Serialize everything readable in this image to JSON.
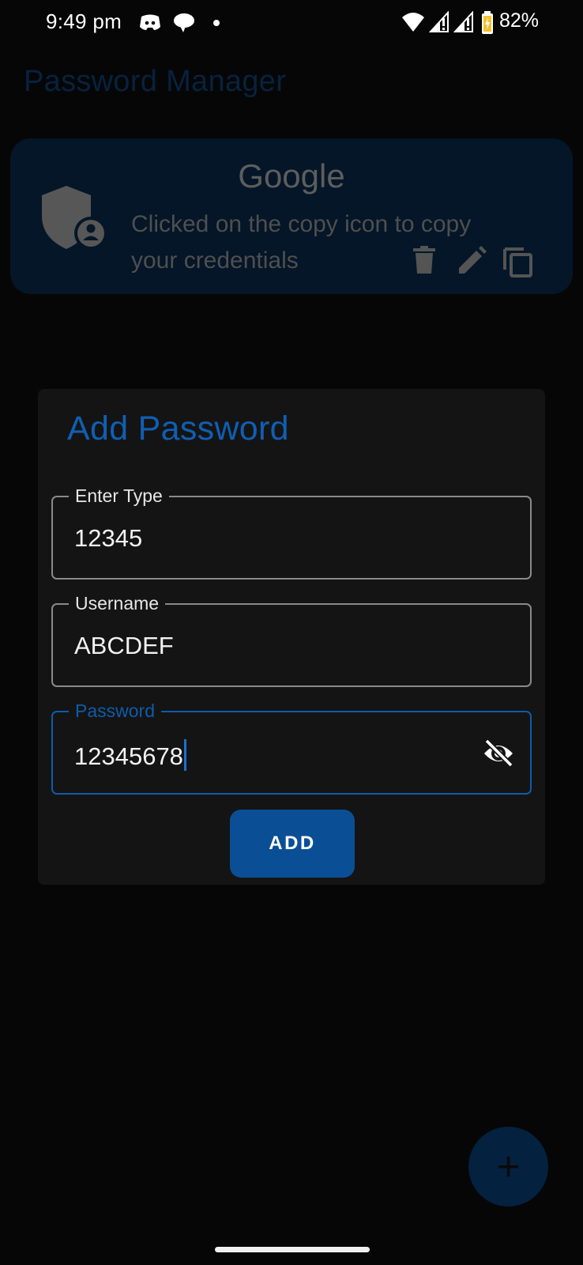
{
  "status_bar": {
    "time": "9:49 pm",
    "battery": "82%"
  },
  "app": {
    "title": "Password Manager"
  },
  "card": {
    "title": "Google",
    "subtitle": "Clicked on the copy icon to copy your credentials",
    "icon": "shield-account-icon",
    "actions": [
      "delete-icon",
      "edit-icon",
      "copy-icon"
    ]
  },
  "dialog": {
    "title": "Add Password",
    "fields": [
      {
        "label": "Enter Type",
        "value": "12345"
      },
      {
        "label": "Username",
        "value": "ABCDEF"
      },
      {
        "label": "Password",
        "value": "12345678"
      }
    ],
    "add_label": "ADD"
  },
  "fab": {
    "icon": "plus-icon"
  },
  "colors": {
    "accent": "#0e5ca9",
    "button": "#0a4f96",
    "dialog_bg": "#141414",
    "card_bg": "#041627"
  }
}
